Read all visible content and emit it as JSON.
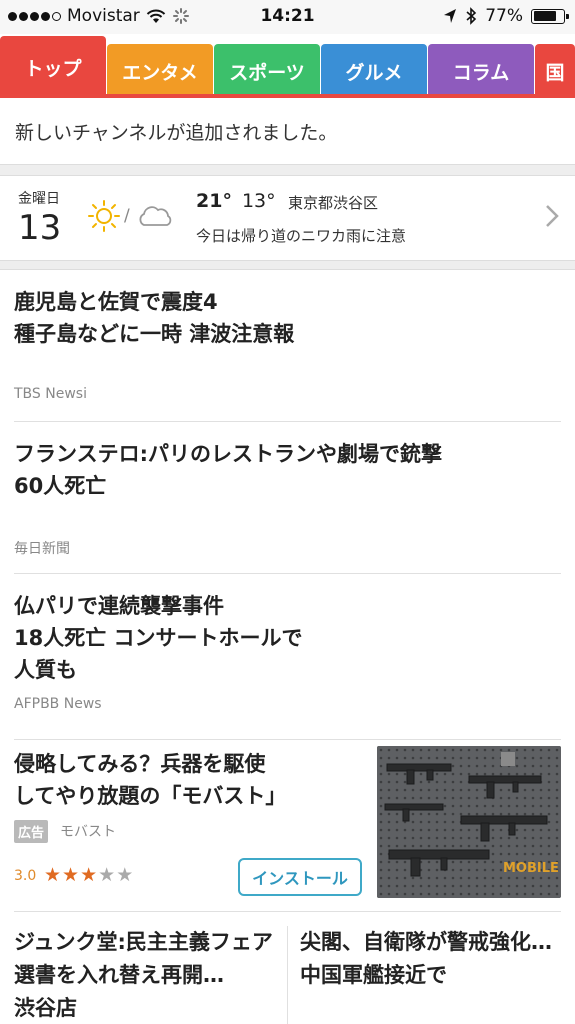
{
  "status_bar": {
    "carrier": "Movistar",
    "time": "14:21",
    "battery": "77%",
    "battery_level": 0.77
  },
  "tabs": [
    {
      "label": "トップ",
      "color": "#e9473f",
      "active": true
    },
    {
      "label": "エンタメ",
      "color": "#f29b25",
      "active": false
    },
    {
      "label": "スポーツ",
      "color": "#3cc06b",
      "active": false
    },
    {
      "label": "グルメ",
      "color": "#3a8fd6",
      "active": false
    },
    {
      "label": "コラム",
      "color": "#8e5bbd",
      "active": false
    },
    {
      "label": "国",
      "color": "#e9473f",
      "active": false
    }
  ],
  "notice": "新しいチャンネルが追加されました。",
  "weather": {
    "day_of_week": "金曜日",
    "day": "13",
    "high": "21°",
    "low": "13°",
    "location": "東京都渋谷区",
    "message": "今日は帰り道のニワカ雨に注意",
    "icons": [
      "sun-icon",
      "cloud-icon"
    ]
  },
  "news": [
    {
      "headline": "鹿児島と佐賀で震度4\n種子島などに一時 津波注意報",
      "source": "TBS Newsi"
    },
    {
      "headline": "フランステロ:パリのレストランや劇場で銃撃\n60人死亡",
      "source": "毎日新聞"
    },
    {
      "headline": "仏パリで連続襲撃事件\n18人死亡 コンサートホールで\n人質も",
      "source": "AFPBB News"
    }
  ],
  "ad": {
    "headline": "侵略してみる？兵器を駆使\nしてやり放題の「モバスト」",
    "badge": "広告",
    "advertiser": "モバスト",
    "rating": "3.0",
    "stars_filled": 3,
    "stars_total": 5,
    "install_label": "インストール",
    "thumb_text": "MOBILE STRIKE"
  },
  "bottom": [
    {
      "headline": "ジュンク堂:民主主義フェア\n選書を入れ替え再開…\n渋谷店"
    },
    {
      "headline": "尖閣、自衛隊が警戒強化…\n中国軍艦接近で"
    }
  ]
}
